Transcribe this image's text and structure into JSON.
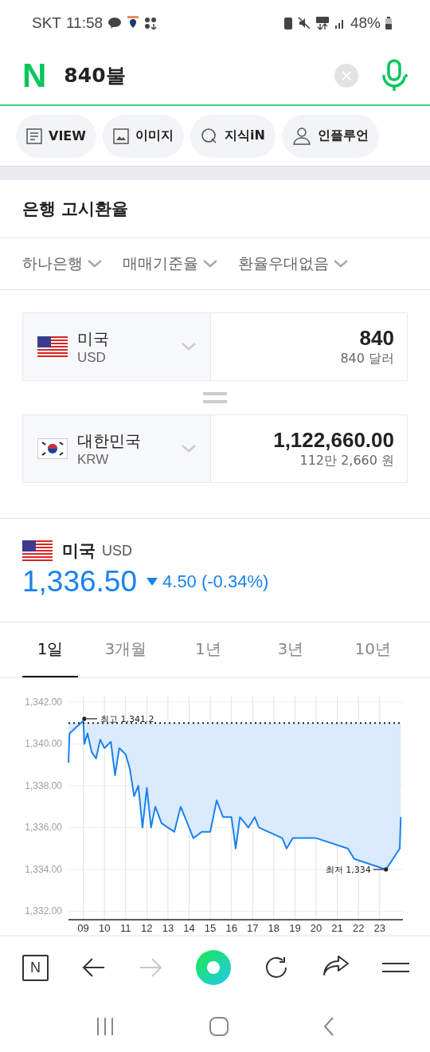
{
  "status_bar": {
    "carrier": "SKT",
    "time": "11:58",
    "battery": "48%"
  },
  "search": {
    "logo": "N",
    "query": "840불"
  },
  "chips": [
    {
      "label": "VIEW",
      "kind": "document"
    },
    {
      "label": "이미지",
      "kind": "image"
    },
    {
      "label": "지식iN",
      "kind": "qna"
    },
    {
      "label": "인플루언",
      "kind": "person"
    }
  ],
  "exchange": {
    "title": "은행 고시환율",
    "filters": [
      "하나은행",
      "매매기준율",
      "환율우대없음"
    ],
    "from": {
      "country": "미국",
      "code": "USD",
      "kind": "us",
      "amount": "840",
      "amount_text": "840 달러"
    },
    "to": {
      "country": "대한민국",
      "code": "KRW",
      "kind": "kr",
      "amount": "1,122,660.00",
      "amount_text": "112만 2,660 원"
    }
  },
  "quote": {
    "country": "미국",
    "code": "USD",
    "kind": "us",
    "price": "1,336.50",
    "falling": true,
    "change": "4.50 (-0.34%)"
  },
  "period_tabs": [
    {
      "label": "1일",
      "selected": true
    },
    {
      "label": "3개월",
      "selected": false
    },
    {
      "label": "1년",
      "selected": false
    },
    {
      "label": "3년",
      "selected": false
    },
    {
      "label": "10년",
      "selected": false
    }
  ],
  "chart_data": {
    "type": "line",
    "grid": true,
    "xticks": [
      {
        "value": 9,
        "label": "09"
      },
      {
        "value": 10,
        "label": "10"
      },
      {
        "value": 11,
        "label": "11"
      },
      {
        "value": 12,
        "label": "12"
      },
      {
        "value": 13,
        "label": "13"
      },
      {
        "value": 14,
        "label": "14"
      },
      {
        "value": 15,
        "label": "15"
      },
      {
        "value": 16,
        "label": "16"
      },
      {
        "value": 17,
        "label": "17"
      },
      {
        "value": 18,
        "label": "18"
      },
      {
        "value": 19,
        "label": "19"
      },
      {
        "value": 20,
        "label": "20"
      },
      {
        "value": 21,
        "label": "21"
      },
      {
        "value": 22,
        "label": "22"
      },
      {
        "value": 23,
        "label": "23"
      }
    ],
    "yticks": [
      {
        "value": 1342,
        "label": "1,342.00"
      },
      {
        "value": 1340,
        "label": "1,340.00"
      },
      {
        "value": 1338,
        "label": "1,338.00"
      },
      {
        "value": 1336,
        "label": "1,336.00"
      },
      {
        "value": 1334,
        "label": "1,334.00"
      },
      {
        "value": 1332,
        "label": "1,332.00"
      }
    ],
    "xlim": [
      8.3,
      24.1
    ],
    "ylim": [
      1331.6,
      1342.3
    ],
    "x": [
      8.3,
      8.35,
      9.0,
      9.05,
      9.2,
      9.4,
      9.6,
      9.8,
      10.0,
      10.3,
      10.5,
      10.7,
      11.0,
      11.2,
      11.4,
      11.6,
      11.8,
      12.0,
      12.2,
      12.4,
      12.7,
      13.0,
      13.3,
      13.6,
      14.0,
      14.2,
      14.6,
      15.0,
      15.3,
      15.6,
      16.0,
      16.2,
      16.4,
      16.8,
      17.1,
      17.3,
      18.4,
      18.6,
      18.9,
      20.0,
      21.5,
      21.8,
      23.3,
      23.95,
      24.0
    ],
    "series": [
      {
        "color": "#1a82f0",
        "values": [
          1339.1,
          1340.5,
          1341.1,
          1340.0,
          1340.5,
          1339.6,
          1339.3,
          1340.2,
          1339.8,
          1340.1,
          1338.5,
          1339.8,
          1339.5,
          1338.8,
          1337.5,
          1338.0,
          1336.0,
          1337.9,
          1336.0,
          1337.0,
          1336.2,
          1336.0,
          1335.8,
          1337.0,
          1336.0,
          1335.5,
          1335.8,
          1335.8,
          1337.3,
          1336.5,
          1336.5,
          1335.0,
          1336.5,
          1336.0,
          1336.5,
          1336.0,
          1335.5,
          1335.0,
          1335.5,
          1335.5,
          1335.0,
          1334.5,
          1334.0,
          1335.0,
          1336.5
        ]
      }
    ],
    "ref_lines": [
      {
        "axis": "y",
        "value": 1341
      }
    ],
    "annotations": [
      {
        "x": 9.05,
        "y": 1341.2,
        "text": "최고 1,341.2"
      },
      {
        "x": 23.3,
        "y": 1334,
        "text": "최저 1,334"
      }
    ]
  },
  "toolbar": {
    "home_label": "N",
    "forward_disabled": true
  }
}
